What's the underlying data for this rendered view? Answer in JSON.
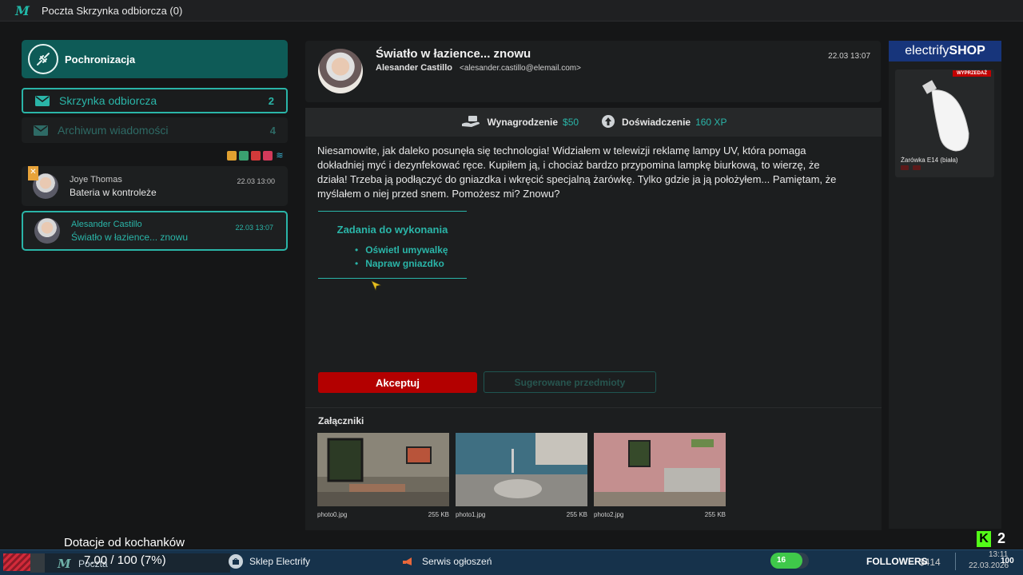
{
  "window": {
    "title": "Poczta Skrzynka odbiorcza (0)",
    "app_icon": "M"
  },
  "sidebar": {
    "brand_name": "Pochronizacja",
    "folders": [
      {
        "label": "Skrzynka odbiorcza",
        "count": "2"
      },
      {
        "label": "Archiwum wiadomości",
        "count": "4"
      }
    ],
    "status_icons": [
      "home-icon",
      "settings-icon",
      "chat-icon",
      "heart-icon",
      "wifi-icon"
    ],
    "messages": [
      {
        "sender": "Joye Thomas",
        "subject": "Bateria w kontroleże",
        "time": "22.03 13:00",
        "tag": "✕"
      },
      {
        "sender": "Alesander Castillo",
        "subject": "Światło w łazience... znowu",
        "time": "22.03 13:07"
      }
    ]
  },
  "email": {
    "subject": "Światło w łazience... znowu",
    "sender_name": "Alesander Castillo",
    "sender_email": "<alesander.castillo@elemail.com>",
    "date": "22.03 13:07",
    "reward_label": "Wynagrodzenie",
    "reward_value": "$50",
    "xp_label": "Doświadczenie",
    "xp_value": "160 XP",
    "body": "Niesamowite, jak daleko posunęła się technologia! Widziałem w telewizji reklamę lampy UV, która pomaga dokładniej myć i dezynfekować ręce. Kupiłem ją, i chociaż bardzo przypomina lampkę biurkową, to wierzę, że działa! Trzeba ją podłączyć do gniazdka i wkręcić specjalną żarówkę. Tylko gdzie ja ją położyłem... Pamiętam, że myślałem o niej przed snem. Pomożesz mi? Znowu?",
    "tasks_title": "Zadania do wykonania",
    "tasks": [
      "Oświetl umywalkę",
      "Napraw gniazdko"
    ],
    "accept_label": "Akceptuj",
    "suggest_label": "Sugerowane przedmioty",
    "attachments_title": "Załączniki",
    "attachments": [
      {
        "name": "photo0.jpg",
        "size": "255 KB"
      },
      {
        "name": "photo1.jpg",
        "size": "255 KB"
      },
      {
        "name": "photo2.jpg",
        "size": "255 KB"
      }
    ]
  },
  "shop": {
    "title_light": "electrify",
    "title_bold": "SHOP",
    "sale_badge": "WYPRZEDAŻ",
    "product_name": "Żarówka E14 (biała)"
  },
  "overlay": {
    "donation_label": "Dotacje od kochanków",
    "donation_progress_text": "7.00 / 100 (7%)",
    "donation_progress": 0.07,
    "kick_count": "2"
  },
  "taskbar": {
    "mail_label": "Poczta",
    "shop_label": "Sklep Electrify",
    "ads_label": "Serwis ogłoszeń",
    "level": "16",
    "followers_label": "FOLLOWERS",
    "money": "$414",
    "time": "13:11",
    "date": "22.03.2026",
    "hundred": "100"
  },
  "colors": {
    "accent": "#2ab5a8",
    "brand_bg": "#0e5b57",
    "accept": "#b30000",
    "shop_head": "#17357b"
  }
}
